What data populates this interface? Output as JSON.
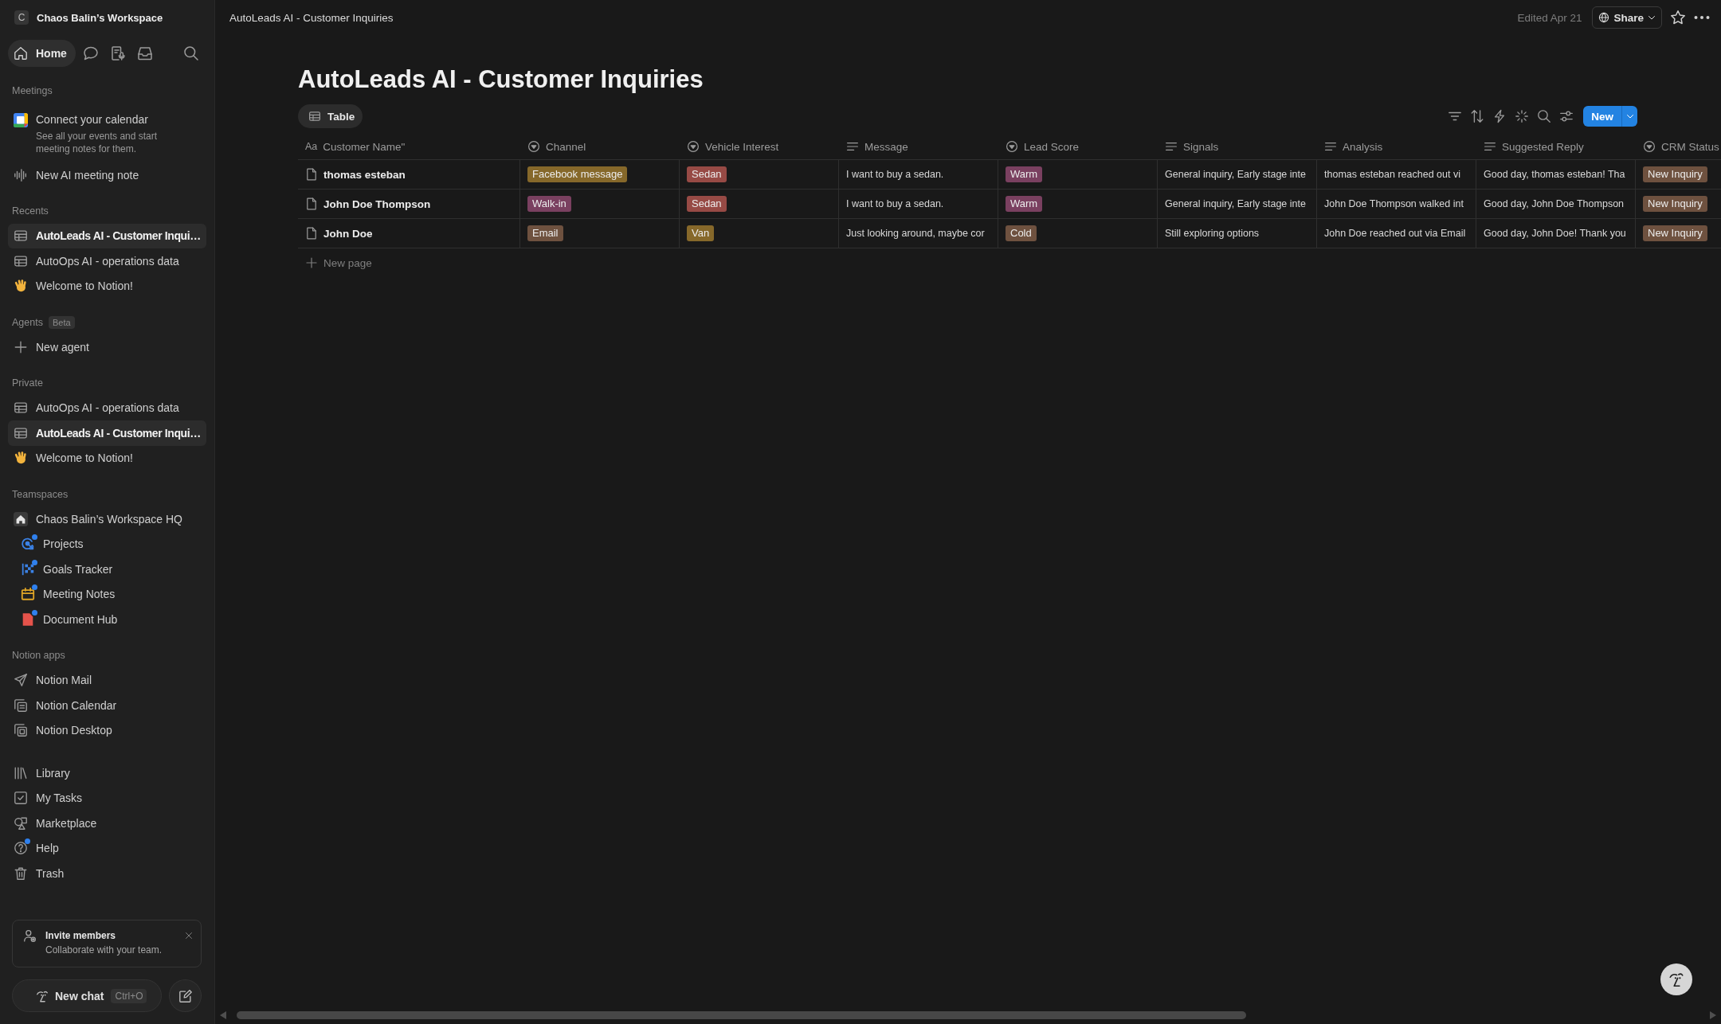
{
  "sidebar": {
    "workspace": {
      "initial": "C",
      "name": "Chaos Balin’s Workspace"
    },
    "home_tab": {
      "label": "Home",
      "selected": true
    },
    "meetings": {
      "label": "Meetings",
      "calendar_prompt": {
        "title": "Connect your calendar",
        "description": "See all your events and start meeting notes for them."
      },
      "new_note": "New AI meeting note"
    },
    "recents": {
      "label": "Recents",
      "items": [
        {
          "kind": "table",
          "label": "AutoLeads AI - Customer Inqui…",
          "selected": true
        },
        {
          "kind": "table",
          "label": "AutoOps AI - operations data",
          "selected": false
        },
        {
          "kind": "hand",
          "label": "Welcome to Notion!",
          "selected": false
        }
      ]
    },
    "agents": {
      "label": "Agents",
      "badge": "Beta",
      "new_agent": "New agent"
    },
    "private": {
      "label": "Private",
      "items": [
        {
          "kind": "table",
          "label": "AutoOps AI - operations data",
          "selected": false
        },
        {
          "kind": "table",
          "label": "AutoLeads AI - Customer Inqui…",
          "selected": true
        },
        {
          "kind": "hand",
          "label": "Welcome to Notion!",
          "selected": false
        }
      ]
    },
    "teamspaces": {
      "label": "Teamspaces",
      "items": [
        {
          "label": "Chaos Balin’s Workspace HQ",
          "children": [
            {
              "kind": "projects",
              "label": "Projects",
              "unread": true
            },
            {
              "kind": "goals",
              "label": "Goals Tracker",
              "unread": true
            },
            {
              "kind": "meeting_notes",
              "label": "Meeting Notes",
              "unread": true
            },
            {
              "kind": "document_hub",
              "label": "Document Hub",
              "unread": true
            }
          ]
        }
      ]
    },
    "apps": {
      "label": "Notion apps",
      "items": [
        {
          "kind": "mail",
          "label": "Notion Mail"
        },
        {
          "kind": "calendar",
          "label": "Notion Calendar"
        },
        {
          "kind": "desktop",
          "label": "Notion Desktop"
        }
      ]
    },
    "links": [
      {
        "kind": "library",
        "label": "Library",
        "unread": false
      },
      {
        "kind": "tasks",
        "label": "My Tasks",
        "unread": false
      },
      {
        "kind": "marketplace",
        "label": "Marketplace",
        "unread": false
      },
      {
        "kind": "help",
        "label": "Help",
        "unread": true
      },
      {
        "kind": "trash",
        "label": "Trash",
        "unread": false
      }
    ],
    "invite": {
      "title": "Invite members",
      "text": "Collaborate with your team."
    },
    "new_chat": {
      "label": "New chat",
      "shortcut": "Ctrl+O"
    }
  },
  "topbar": {
    "breadcrumb": "AutoLeads AI - Customer Inquiries",
    "edited": "Edited Apr 21",
    "share": "Share"
  },
  "page": {
    "title": "AutoLeads AI - Customer Inquiries",
    "views": [
      {
        "label": "Table",
        "selected": true
      }
    ],
    "new_button": "New",
    "table": {
      "columns": [
        {
          "kind": "title",
          "glyph": "Aa",
          "label": "Customer Name\""
        },
        {
          "kind": "select",
          "label": "Channel"
        },
        {
          "kind": "select",
          "label": "Vehicle Interest"
        },
        {
          "kind": "text",
          "label": "Message"
        },
        {
          "kind": "select",
          "label": "Lead Score"
        },
        {
          "kind": "text",
          "label": "Signals"
        },
        {
          "kind": "text",
          "label": "Analysis"
        },
        {
          "kind": "text",
          "label": "Suggested Reply"
        },
        {
          "kind": "select",
          "label": "CRM Status"
        }
      ],
      "rows": [
        {
          "cells": [
            {
              "text": "thomas esteban"
            },
            {
              "text": "Facebook message",
              "color": "#86682a"
            },
            {
              "text": "Sedan",
              "color": "#974a45"
            },
            {
              "text": "I want to buy a sedan."
            },
            {
              "text": "Warm",
              "color": "#7a4060"
            },
            {
              "text": "General inquiry, Early stage inte"
            },
            {
              "text": "thomas esteban reached out vi"
            },
            {
              "text": "Good day, thomas esteban! Tha"
            },
            {
              "text": "New Inquiry",
              "color": "#6e513f"
            }
          ]
        },
        {
          "cells": [
            {
              "text": "John Doe Thompson"
            },
            {
              "text": "Walk-in",
              "color": "#7a4060"
            },
            {
              "text": "Sedan",
              "color": "#974a45"
            },
            {
              "text": "I want to buy a sedan."
            },
            {
              "text": "Warm",
              "color": "#7a4060"
            },
            {
              "text": "General inquiry, Early stage inte"
            },
            {
              "text": "John Doe Thompson walked int"
            },
            {
              "text": "Good day, John Doe Thompson"
            },
            {
              "text": "New Inquiry",
              "color": "#6e513f"
            }
          ]
        },
        {
          "cells": [
            {
              "text": "John Doe"
            },
            {
              "text": "Email",
              "color": "#6e513f"
            },
            {
              "text": "Van",
              "color": "#86682a"
            },
            {
              "text": "Just looking around, maybe cor"
            },
            {
              "text": "Cold",
              "color": "#6e513f"
            },
            {
              "text": "Still exploring options"
            },
            {
              "text": "John Doe reached out via Email"
            },
            {
              "text": "Good day, John Doe! Thank you"
            },
            {
              "text": "New Inquiry",
              "color": "#6e513f"
            }
          ]
        }
      ],
      "new_row": "New page"
    }
  }
}
